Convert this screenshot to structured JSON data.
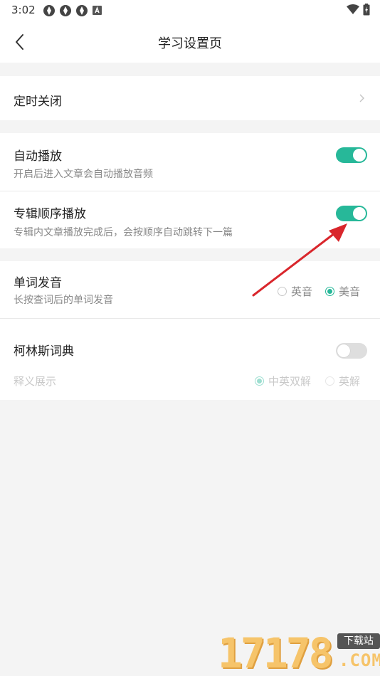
{
  "status_bar": {
    "time": "3:02"
  },
  "header": {
    "title": "学习设置页"
  },
  "settings": {
    "timer_close": {
      "title": "定时关闭"
    },
    "auto_play": {
      "title": "自动播放",
      "subtitle": "开启后进入文章会自动播放音频",
      "enabled": true
    },
    "album_order": {
      "title": "专辑顺序播放",
      "subtitle": "专辑内文章播放完成后，会按顺序自动跳转下一篇",
      "enabled": true
    },
    "pronunciation": {
      "title": "单词发音",
      "subtitle": "长按查词后的单词发音",
      "options": [
        "英音",
        "美音"
      ],
      "selected": "美音"
    },
    "collins": {
      "title": "柯林斯词典",
      "enabled": false,
      "display_label": "释义展示",
      "options": [
        "中英双解",
        "英解"
      ],
      "selected": "中英双解"
    }
  },
  "watermark": {
    "number": "17178",
    "badge": "下载站",
    "suffix": ".COM"
  },
  "colors": {
    "accent": "#27b899",
    "annotation_arrow": "#d9262c"
  }
}
